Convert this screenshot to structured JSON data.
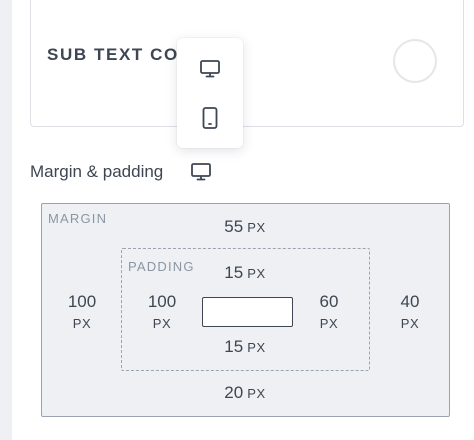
{
  "color_setting": {
    "label": "SUB TEXT COL",
    "swatch_color": "#ffffff"
  },
  "device_menu": {
    "options": [
      {
        "icon": "desktop-icon"
      },
      {
        "icon": "mobile-icon"
      }
    ]
  },
  "spacing": {
    "title": "Margin & padding",
    "title_icon": "desktop-icon",
    "margin": {
      "caption": "MARGIN",
      "top": {
        "value": "55",
        "unit": "PX"
      },
      "right": {
        "value": "40",
        "unit": "PX"
      },
      "bottom": {
        "value": "20",
        "unit": "PX"
      },
      "left": {
        "value": "100",
        "unit": "PX"
      }
    },
    "padding": {
      "caption": "PADDING",
      "top": {
        "value": "15",
        "unit": "PX"
      },
      "right": {
        "value": "60",
        "unit": "PX"
      },
      "bottom": {
        "value": "15",
        "unit": "PX"
      },
      "left": {
        "value": "100",
        "unit": "PX"
      }
    }
  },
  "colors": {
    "text": "#3d4652",
    "box_fill": "#eef0f3",
    "box_border": "#9aa4b0",
    "caption": "#8b96a3"
  }
}
